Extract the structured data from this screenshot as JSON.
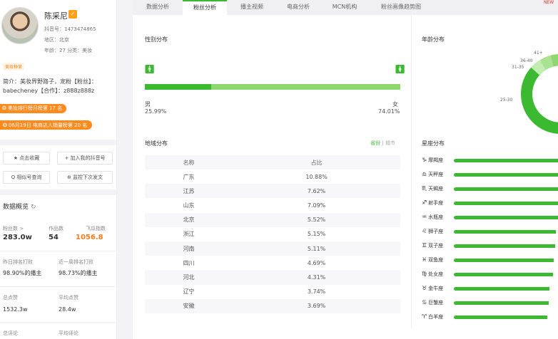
{
  "profile": {
    "name": "陈采尼",
    "douyin_id": "抖音号：1473474865",
    "region": "地区：北京",
    "age_category": "年龄：27   分类：美妆",
    "tag": "美妆种草",
    "bio": "简介：美妆界野路子，宠粉【粉丝】：babecheney【合作】：z888z888z",
    "rank1": "美妆排行榜月榜第 17 名",
    "rank2": "06月19日 电商达人销量榜第 20 名"
  },
  "actions": {
    "collect": "★ 点击收藏",
    "add_douyin": "+ 加入我的抖音号",
    "similar": "Q 相似号查询",
    "monitor": "⊕ 监控下次发文"
  },
  "overview": {
    "title": "数据概览",
    "fans_label": "粉丝数 >",
    "fans_value": "283.0w",
    "works_label": "作品数",
    "works_value": "54",
    "index_label": "飞瓜指数",
    "index_value": "1056.8",
    "yesterday_label": "昨日排名打败",
    "yesterday_value": "98.90%的播主",
    "week_label": "近一周排名打败",
    "week_value": "98.73%的播主",
    "likes_label": "总点赞",
    "likes_value": "1532.3w",
    "avg_likes_label": "平均点赞",
    "avg_likes_value": "28.4w",
    "comments_label": "总评论",
    "avg_comments_label": "平均评论"
  },
  "tabs": [
    "数据分析",
    "粉丝分析",
    "播主视频",
    "电商分析",
    "MCN机构",
    "粉丝画像趋势图"
  ],
  "active_tab": 1,
  "tab_extra": "NEW",
  "gender": {
    "title": "性别分布",
    "male_label": "男",
    "male_pct": "25.99%",
    "female_label": "女",
    "female_pct": "74.01%",
    "male_fraction": 0.2599
  },
  "region": {
    "title": "地域分布",
    "seg_province": "省份",
    "seg_city": "城市",
    "col_name": "名称",
    "col_share": "占比",
    "rows": [
      {
        "name": "广东",
        "share": "10.88%"
      },
      {
        "name": "江苏",
        "share": "7.62%"
      },
      {
        "name": "山东",
        "share": "7.09%"
      },
      {
        "name": "北京",
        "share": "5.52%"
      },
      {
        "name": "浙江",
        "share": "5.15%"
      },
      {
        "name": "河南",
        "share": "5.11%"
      },
      {
        "name": "四川",
        "share": "4.69%"
      },
      {
        "name": "河北",
        "share": "4.31%"
      },
      {
        "name": "辽宁",
        "share": "3.74%"
      },
      {
        "name": "安徽",
        "share": "3.69%"
      }
    ]
  },
  "age": {
    "title": "年龄分布",
    "labels": [
      "41+",
      "36-40",
      "31-35",
      "25-30"
    ]
  },
  "zodiac": {
    "title": "星座分布",
    "items": [
      {
        "icon": "♑",
        "name": "摩羯座",
        "level": 1.0
      },
      {
        "icon": "♎",
        "name": "天秤座",
        "level": 1.0
      },
      {
        "icon": "♏",
        "name": "天蝎座",
        "level": 1.0
      },
      {
        "icon": "♐",
        "name": "射手座",
        "level": 1.0
      },
      {
        "icon": "♒",
        "name": "水瓶座",
        "level": 1.0
      },
      {
        "icon": "♌",
        "name": "狮子座",
        "level": 0.98
      },
      {
        "icon": "♊",
        "name": "双子座",
        "level": 0.97
      },
      {
        "icon": "♓",
        "name": "双鱼座",
        "level": 0.96
      },
      {
        "icon": "♍",
        "name": "处女座",
        "level": 0.95
      },
      {
        "icon": "♉",
        "name": "金牛座",
        "level": 0.92
      },
      {
        "icon": "♋",
        "name": "巨蟹座",
        "level": 0.91
      },
      {
        "icon": "♈",
        "name": "白羊座",
        "level": 0.9
      }
    ]
  },
  "colors": {
    "accent": "#3bba31",
    "accent_light": "#8ed870",
    "orange": "#ff8a1e"
  }
}
